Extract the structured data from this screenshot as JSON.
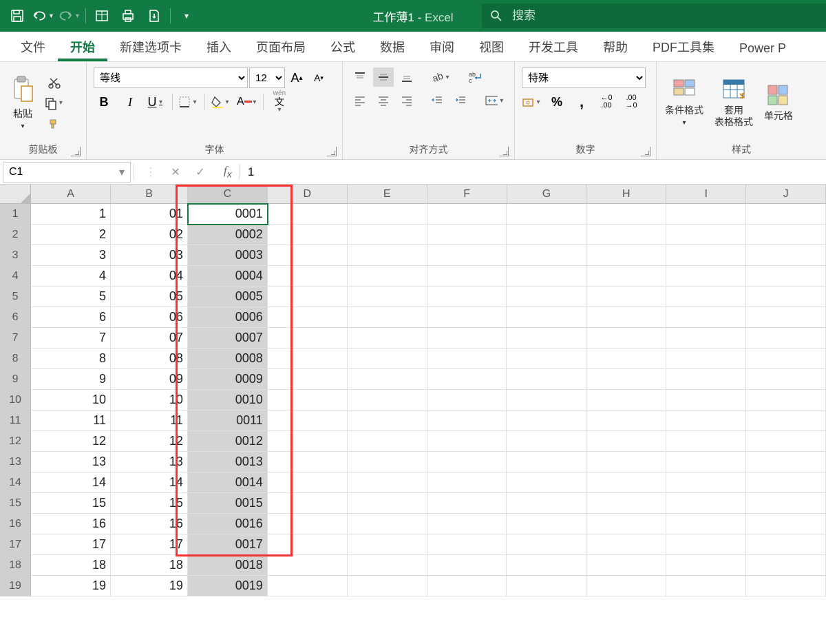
{
  "titlebar": {
    "doc_title": "工作薄1",
    "app_name": "Excel",
    "search_placeholder": "搜索"
  },
  "tabs": [
    "文件",
    "开始",
    "新建选项卡",
    "插入",
    "页面布局",
    "公式",
    "数据",
    "审阅",
    "视图",
    "开发工具",
    "帮助",
    "PDF工具集",
    "Power P"
  ],
  "active_tab": 1,
  "ribbon": {
    "clipboard": {
      "paste": "粘贴",
      "label": "剪贴板"
    },
    "font": {
      "name": "等线",
      "size": "12",
      "label": "字体",
      "bold": "B",
      "italic": "I",
      "underline": "U",
      "wen": "wén",
      "wen2": "文"
    },
    "align": {
      "label": "对齐方式"
    },
    "number": {
      "format": "特殊",
      "label": "数字"
    },
    "styles": {
      "cond": "条件格式",
      "table": "套用\n表格格式",
      "cell": "单元格",
      "label": "样式"
    }
  },
  "formula": {
    "namebox": "C1",
    "value": "1"
  },
  "columns": [
    "A",
    "B",
    "C",
    "D",
    "E",
    "F",
    "G",
    "H",
    "I",
    "J"
  ],
  "rows": [
    {
      "n": "1",
      "A": "1",
      "B": "01",
      "C": "0001"
    },
    {
      "n": "2",
      "A": "2",
      "B": "02",
      "C": "0002"
    },
    {
      "n": "3",
      "A": "3",
      "B": "03",
      "C": "0003"
    },
    {
      "n": "4",
      "A": "4",
      "B": "04",
      "C": "0004"
    },
    {
      "n": "5",
      "A": "5",
      "B": "05",
      "C": "0005"
    },
    {
      "n": "6",
      "A": "6",
      "B": "06",
      "C": "0006"
    },
    {
      "n": "7",
      "A": "7",
      "B": "07",
      "C": "0007"
    },
    {
      "n": "8",
      "A": "8",
      "B": "08",
      "C": "0008"
    },
    {
      "n": "9",
      "A": "9",
      "B": "09",
      "C": "0009"
    },
    {
      "n": "10",
      "A": "10",
      "B": "10",
      "C": "0010"
    },
    {
      "n": "11",
      "A": "11",
      "B": "11",
      "C": "0011"
    },
    {
      "n": "12",
      "A": "12",
      "B": "12",
      "C": "0012"
    },
    {
      "n": "13",
      "A": "13",
      "B": "13",
      "C": "0013"
    },
    {
      "n": "14",
      "A": "14",
      "B": "14",
      "C": "0014"
    },
    {
      "n": "15",
      "A": "15",
      "B": "15",
      "C": "0015"
    },
    {
      "n": "16",
      "A": "16",
      "B": "16",
      "C": "0016"
    },
    {
      "n": "17",
      "A": "17",
      "B": "17",
      "C": "0017"
    },
    {
      "n": "18",
      "A": "18",
      "B": "18",
      "C": "0018"
    },
    {
      "n": "19",
      "A": "19",
      "B": "19",
      "C": "0019"
    }
  ],
  "selected_col": "C",
  "active_cell": "C1"
}
